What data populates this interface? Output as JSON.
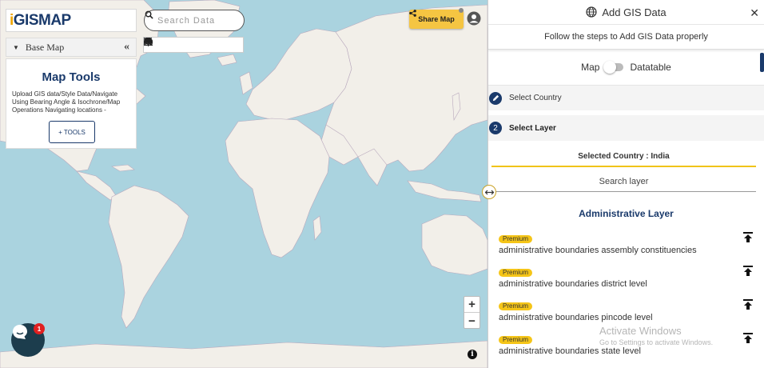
{
  "logo": {
    "text": "GISMAP",
    "prefix": "i"
  },
  "base_map": {
    "label": "Base Map"
  },
  "map_tools": {
    "title": "Map Tools",
    "description": "Upload GIS data/Style Data/Navigate Using Bearing Angle & Isochrone/Map Operations Navigating locations -",
    "button_label": "+ TOOLS"
  },
  "search": {
    "placeholder": "Search Data"
  },
  "toolbar_icons": [
    "locate-icon",
    "fullscreen-icon",
    "print-icon",
    "zoom-search-icon",
    "measure-icon",
    "layers-icon"
  ],
  "share": {
    "label": "Share Map"
  },
  "zoom": {
    "in": "+",
    "out": "−"
  },
  "info": {
    "label": "i"
  },
  "chat": {
    "badge": "1"
  },
  "panel": {
    "title": "Add GIS Data",
    "subtitle": "Follow the steps to Add GIS Data properly",
    "toggle": {
      "left": "Map",
      "right": "Datatable"
    },
    "steps": [
      {
        "label": "Select Country"
      },
      {
        "number": "2",
        "label": "Select Layer"
      }
    ],
    "selected_country": "Selected Country : India",
    "search_layer_placeholder": "Search layer",
    "section_title": "Administrative Layer",
    "layers": [
      {
        "badge": "Premium",
        "name": "administrative boundaries assembly constituencies"
      },
      {
        "badge": "Premium",
        "name": "administrative boundaries district level"
      },
      {
        "badge": "Premium",
        "name": "administrative boundaries pincode level"
      },
      {
        "badge": "Premium",
        "name": "administrative boundaries state level"
      }
    ]
  },
  "watermark": {
    "line1": "Activate Windows",
    "line2": "Go to Settings to activate Windows."
  },
  "colors": {
    "brand": "#1a3a6b",
    "accent": "#f5c518",
    "ocean": "#aad3df",
    "land": "#f2efe9"
  }
}
